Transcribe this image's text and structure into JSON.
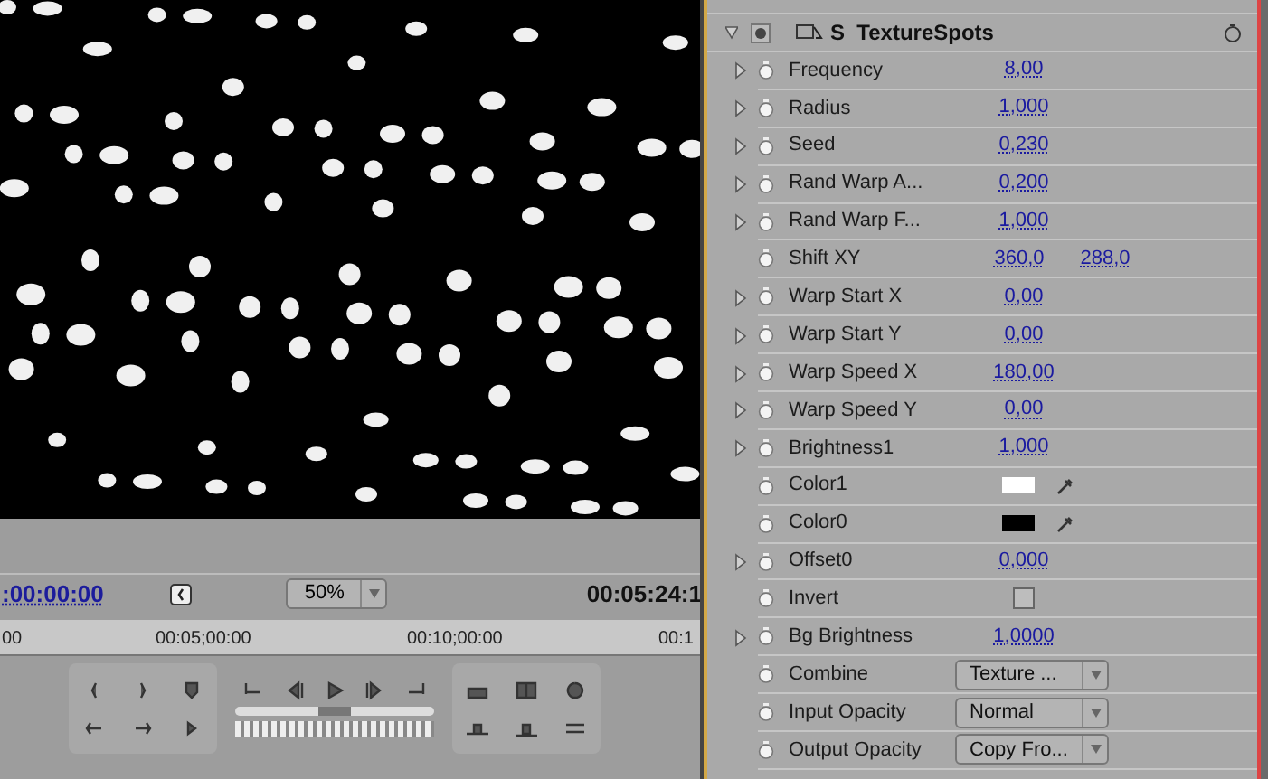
{
  "monitor": {
    "current_time": ":00:00:00",
    "zoom": "50%",
    "shuttle": {
      "level": 0.5
    },
    "duration": "00:05:24:1",
    "ruler_labels": [
      "00",
      "00:05;00:00",
      "00:10;00:00",
      "00:1"
    ]
  },
  "effect": {
    "name": "S_TextureSpots",
    "expanded": true,
    "params": [
      {
        "kind": "number",
        "label": "Frequency",
        "expandable": true,
        "value": "8,00"
      },
      {
        "kind": "number",
        "label": "Radius",
        "expandable": true,
        "value": "1,000"
      },
      {
        "kind": "number",
        "label": "Seed",
        "expandable": true,
        "value": "0,230"
      },
      {
        "kind": "number",
        "label": "Rand Warp A...",
        "expandable": true,
        "value": "0,200"
      },
      {
        "kind": "number",
        "label": "Rand Warp F...",
        "expandable": true,
        "value": "1,000"
      },
      {
        "kind": "point",
        "label": "Shift XY",
        "expandable": false,
        "value": "360,0",
        "value2": "288,0"
      },
      {
        "kind": "number",
        "label": "Warp Start X",
        "expandable": true,
        "value": "0,00"
      },
      {
        "kind": "number",
        "label": "Warp Start Y",
        "expandable": true,
        "value": "0,00"
      },
      {
        "kind": "number",
        "label": "Warp Speed X",
        "expandable": true,
        "value": "180,00"
      },
      {
        "kind": "number",
        "label": "Warp Speed Y",
        "expandable": true,
        "value": "0,00"
      },
      {
        "kind": "number",
        "label": "Brightness1",
        "expandable": true,
        "value": "1,000"
      },
      {
        "kind": "color",
        "label": "Color1",
        "expandable": false,
        "color": "#ffffff"
      },
      {
        "kind": "color",
        "label": "Color0",
        "expandable": false,
        "color": "#000000"
      },
      {
        "kind": "number",
        "label": "Offset0",
        "expandable": true,
        "value": "0,000"
      },
      {
        "kind": "checkbox",
        "label": "Invert",
        "expandable": false,
        "checked": false
      },
      {
        "kind": "number",
        "label": "Bg Brightness",
        "expandable": true,
        "value": "1,0000"
      },
      {
        "kind": "dropdown",
        "label": "Combine",
        "expandable": false,
        "value": "Texture ..."
      },
      {
        "kind": "dropdown",
        "label": "Input Opacity",
        "expandable": false,
        "value": "Normal"
      },
      {
        "kind": "dropdown",
        "label": "Output Opacity",
        "expandable": false,
        "value": "Copy Fro..."
      }
    ]
  }
}
